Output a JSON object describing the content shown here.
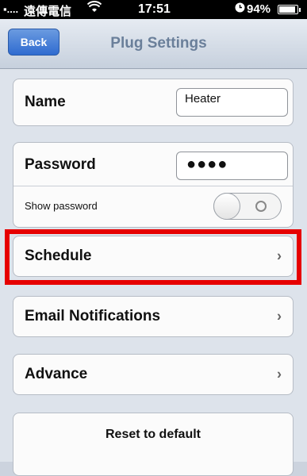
{
  "status_bar": {
    "signal": "▪....",
    "carrier": "遠傳電信",
    "wifi_icon": "wifi-icon",
    "time": "17:51",
    "clock_icon": "clock-icon",
    "battery": "94%"
  },
  "nav": {
    "back_label": "Back",
    "title": "Plug Settings"
  },
  "name_row": {
    "label": "Name",
    "value": "Heater"
  },
  "password_group": {
    "label": "Password",
    "value": "●●●●",
    "show_label": "Show password",
    "toggle_on": false
  },
  "schedule": {
    "label": "Schedule",
    "chevron": "›"
  },
  "email": {
    "label": "Email Notifications",
    "chevron": "›"
  },
  "advance": {
    "label": "Advance",
    "chevron": "›"
  },
  "reset": {
    "label": "Reset to default"
  },
  "colors": {
    "highlight": "#e60000",
    "nav_title": "#6a7f9a",
    "back_button": "#2f6bd0"
  }
}
